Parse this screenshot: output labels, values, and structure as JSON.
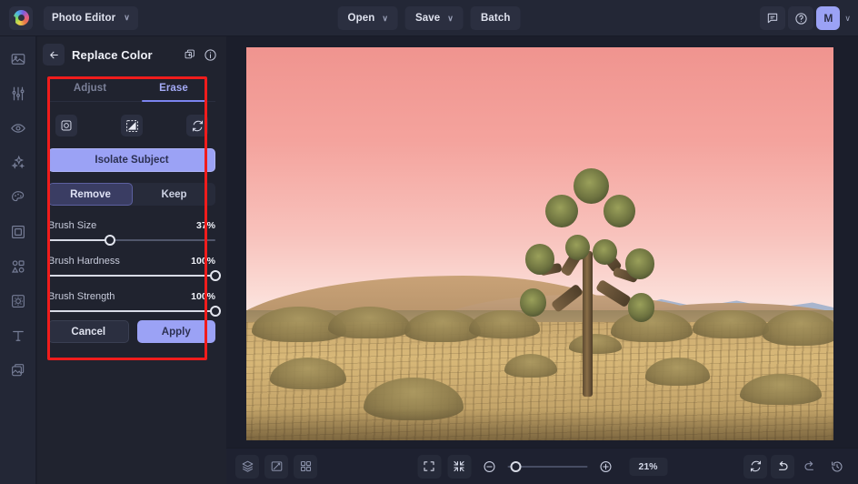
{
  "topbar": {
    "logo_icon": "color-wheel-logo-icon",
    "app_menu_label": "Photo Editor",
    "app_menu_caret": "∨",
    "buttons": [
      {
        "label": "Open",
        "caret": "∨",
        "has_caret": true,
        "name": "open-button"
      },
      {
        "label": "Save",
        "caret": "∨",
        "has_caret": true,
        "name": "save-button"
      },
      {
        "label": "Batch",
        "caret": "",
        "has_caret": false,
        "name": "batch-button"
      }
    ],
    "right": {
      "feedback_icon": "chat-bubble-icon",
      "help_icon": "question-circle-icon",
      "avatar_initial": "M",
      "avatar_caret": "∨"
    }
  },
  "sidebar": {
    "items": [
      {
        "label": "Image",
        "icon": "image-icon"
      },
      {
        "label": "Adjust",
        "icon": "sliders-icon"
      },
      {
        "label": "Retouch",
        "icon": "eye-icon"
      },
      {
        "label": "Effects",
        "icon": "sparkles-icon"
      },
      {
        "label": "Color",
        "icon": "palette-icon"
      },
      {
        "label": "Frame",
        "icon": "frame-icon"
      },
      {
        "label": "Shapes",
        "icon": "shapes-icon"
      },
      {
        "label": "Overlay",
        "icon": "overlay-icon"
      },
      {
        "label": "Text",
        "icon": "text-icon"
      },
      {
        "label": "Layers",
        "icon": "layers-copy-icon"
      }
    ]
  },
  "panel": {
    "back_icon": "arrow-left-icon",
    "title": "Replace Color",
    "duplicate_icon": "copy-layers-icon",
    "info_icon": "info-circle-icon",
    "tabs": [
      {
        "label": "Adjust",
        "active": false
      },
      {
        "label": "Erase",
        "active": true
      }
    ],
    "tools": [
      {
        "name": "selection-tool-icon",
        "active": false
      },
      {
        "name": "mask-checker-tool-icon",
        "active": true
      },
      {
        "name": "refresh-tool-icon",
        "active": false
      }
    ],
    "isolate_button": "Isolate Subject",
    "mode_segments": [
      {
        "label": "Remove",
        "active": true
      },
      {
        "label": "Keep",
        "active": false
      }
    ],
    "sliders": [
      {
        "label": "Brush Size",
        "value": "37%",
        "percent": 37
      },
      {
        "label": "Brush Hardness",
        "value": "100%",
        "percent": 100
      },
      {
        "label": "Brush Strength",
        "value": "100%",
        "percent": 100
      }
    ],
    "cancel_label": "Cancel",
    "apply_label": "Apply"
  },
  "bottombar": {
    "left_icons": [
      {
        "name": "layers-stack-icon"
      },
      {
        "name": "compare-icon"
      },
      {
        "name": "grid-icon"
      }
    ],
    "center": {
      "fit_icon": "fit-to-screen-icon",
      "shrink_icon": "shrink-icon",
      "zoom_out_icon": "zoom-out-icon",
      "zoom_in_icon": "zoom-in-icon",
      "zoom_level": "21%",
      "zoom_knob_percent": 4
    },
    "right_icons": [
      {
        "name": "reset-icon"
      },
      {
        "name": "undo-icon"
      },
      {
        "name": "redo-icon"
      },
      {
        "name": "history-icon"
      }
    ]
  },
  "colors": {
    "accent": "#9ba2f5",
    "panel_bg": "#20232f",
    "topbar_bg": "#232736",
    "canvas_bg": "#1b1e2b",
    "annotation_red": "#f01c1c"
  }
}
